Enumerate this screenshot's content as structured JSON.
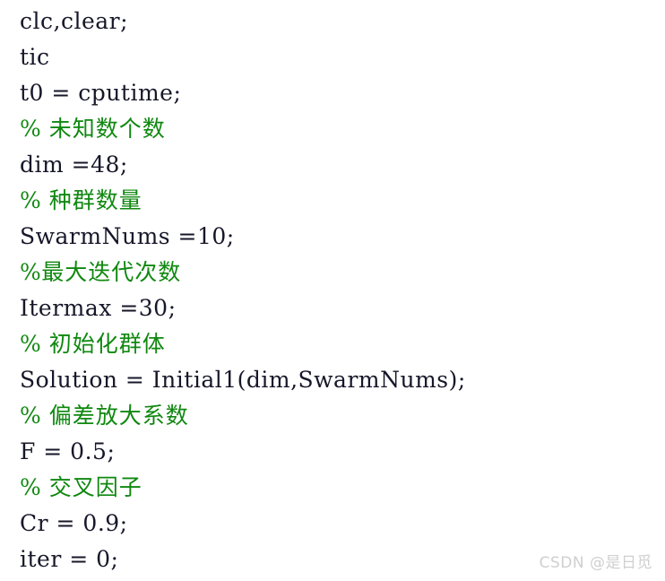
{
  "page": {
    "background_color": "#ffffff",
    "code_color": "#17172a",
    "comment_color": "#108810",
    "watermark_color": "#cfcfcf",
    "language": "MATLAB"
  },
  "code": {
    "lines": [
      {
        "text": "clc,clear;",
        "kind": "code"
      },
      {
        "text": "tic",
        "kind": "code"
      },
      {
        "text": "t0 = cputime;",
        "kind": "code"
      },
      {
        "text": "% 未知数个数",
        "kind": "comment"
      },
      {
        "text": "dim =48;",
        "kind": "code"
      },
      {
        "text": "% 种群数量",
        "kind": "comment"
      },
      {
        "text": "SwarmNums =10;",
        "kind": "code"
      },
      {
        "text": "%最大迭代次数",
        "kind": "comment"
      },
      {
        "text": "Itermax =30;",
        "kind": "code"
      },
      {
        "text": "% 初始化群体",
        "kind": "comment"
      },
      {
        "text": "Solution = Initial1(dim,SwarmNums);",
        "kind": "code"
      },
      {
        "text": "% 偏差放大系数",
        "kind": "comment"
      },
      {
        "text": "F = 0.5;",
        "kind": "code"
      },
      {
        "text": "% 交叉因子",
        "kind": "comment"
      },
      {
        "text": "Cr = 0.9;",
        "kind": "code"
      },
      {
        "text": "iter = 0;",
        "kind": "code"
      }
    ]
  },
  "watermark": {
    "text": "CSDN @是日觅"
  }
}
